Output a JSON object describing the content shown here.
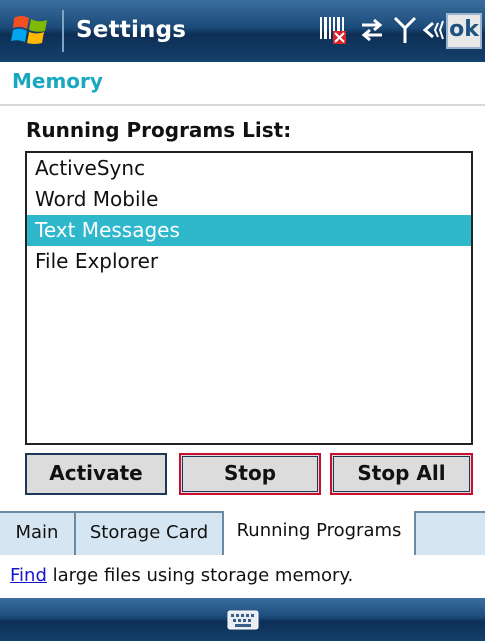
{
  "titlebar": {
    "title": "Settings",
    "ok_label": "ok",
    "icons": [
      "windows-start-icon",
      "barcode-icon",
      "sync-icon",
      "signal-icon",
      "volume-icon"
    ]
  },
  "page": {
    "title": "Memory",
    "list_label": "Running Programs List:"
  },
  "running_programs": {
    "items": [
      "ActiveSync",
      "Word Mobile",
      "Text Messages",
      "File Explorer"
    ],
    "selected": "Text Messages"
  },
  "buttons": {
    "activate": "Activate",
    "stop": "Stop",
    "stop_all": "Stop All"
  },
  "tabs": {
    "items": [
      "Main",
      "Storage Card",
      "Running Programs"
    ],
    "active": "Running Programs"
  },
  "footer": {
    "link_text": "Find",
    "rest_text": " large files using storage memory."
  },
  "bottombar": {
    "icon": "keyboard-icon"
  },
  "colors": {
    "title_bar": "#1b4a78",
    "accent": "#1aa7c2",
    "selection": "#2fb7cc",
    "link": "#1515d0",
    "focus_border": "#c8102e"
  }
}
